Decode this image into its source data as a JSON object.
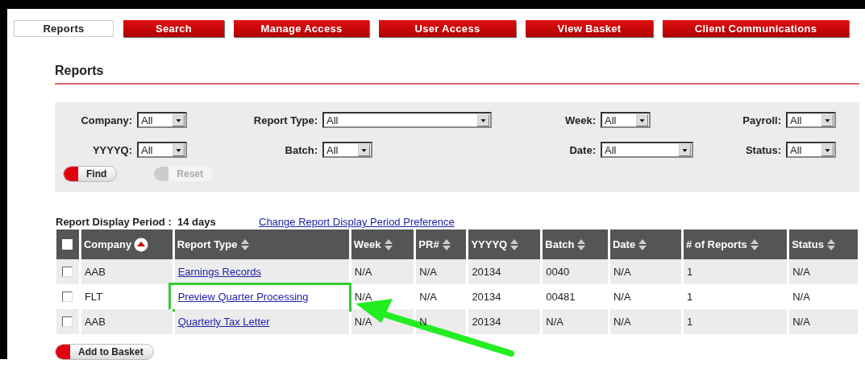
{
  "tabs": [
    {
      "label": "Reports",
      "selected": true
    },
    {
      "label": "Search",
      "selected": false
    },
    {
      "label": "Manage Access",
      "selected": false
    },
    {
      "label": "User Access",
      "selected": false
    },
    {
      "label": "View Basket",
      "selected": false
    },
    {
      "label": "Client Communications",
      "selected": false
    }
  ],
  "heading": "Reports",
  "filters": [
    {
      "label": "Company:",
      "value": "All",
      "wide": false
    },
    {
      "label": "Report Type:",
      "value": "All",
      "wide": true
    },
    {
      "label": "Week:",
      "value": "All",
      "wide": false
    },
    {
      "label": "Payroll:",
      "value": "All",
      "wide": false
    },
    {
      "label": "YYYYQ:",
      "value": "All",
      "wide": false
    },
    {
      "label": "Batch:",
      "value": "All",
      "wide": false
    },
    {
      "label": "Date:",
      "value": "All",
      "wide": true
    },
    {
      "label": "Status:",
      "value": "All",
      "wide": false
    }
  ],
  "filter_buttons": [
    {
      "label": "Find",
      "disabled": false
    },
    {
      "label": "Reset",
      "disabled": true
    }
  ],
  "period": {
    "label": "Report Display Period :",
    "value": "14 days"
  },
  "period_link": "Change Report Display Period Preference",
  "table": {
    "select_all_checked": false,
    "columns": [
      {
        "label": "Company",
        "sorted": true
      },
      {
        "label": "Report Type",
        "sorted": false
      },
      {
        "label": "Week",
        "sorted": false
      },
      {
        "label": "PR#",
        "sorted": false
      },
      {
        "label": "YYYYQ",
        "sorted": false
      },
      {
        "label": "Batch",
        "sorted": false
      },
      {
        "label": "Date",
        "sorted": false
      },
      {
        "label": "# of Reports",
        "sorted": false
      },
      {
        "label": "Status",
        "sorted": false
      }
    ],
    "rows": [
      {
        "checked": false,
        "highlighted": false,
        "cells": [
          "AAB",
          "Earnings Records",
          "N/A",
          "N/A",
          "20134",
          "0040",
          "N/A",
          "1",
          "N/A"
        ]
      },
      {
        "checked": false,
        "highlighted": true,
        "cells": [
          "FLT",
          "Preview Quarter Processing",
          "N/A",
          "N/A",
          "20134",
          "00481",
          "N/A",
          "1",
          "N/A"
        ]
      },
      {
        "checked": false,
        "highlighted": false,
        "cells": [
          "AAB",
          "Quarterly Tax Letter",
          "N/A",
          "N",
          "20134",
          "N/A",
          "N/A",
          "1",
          "N/A"
        ]
      }
    ]
  },
  "basket_button": {
    "label": "Add to Basket",
    "disabled": false
  }
}
